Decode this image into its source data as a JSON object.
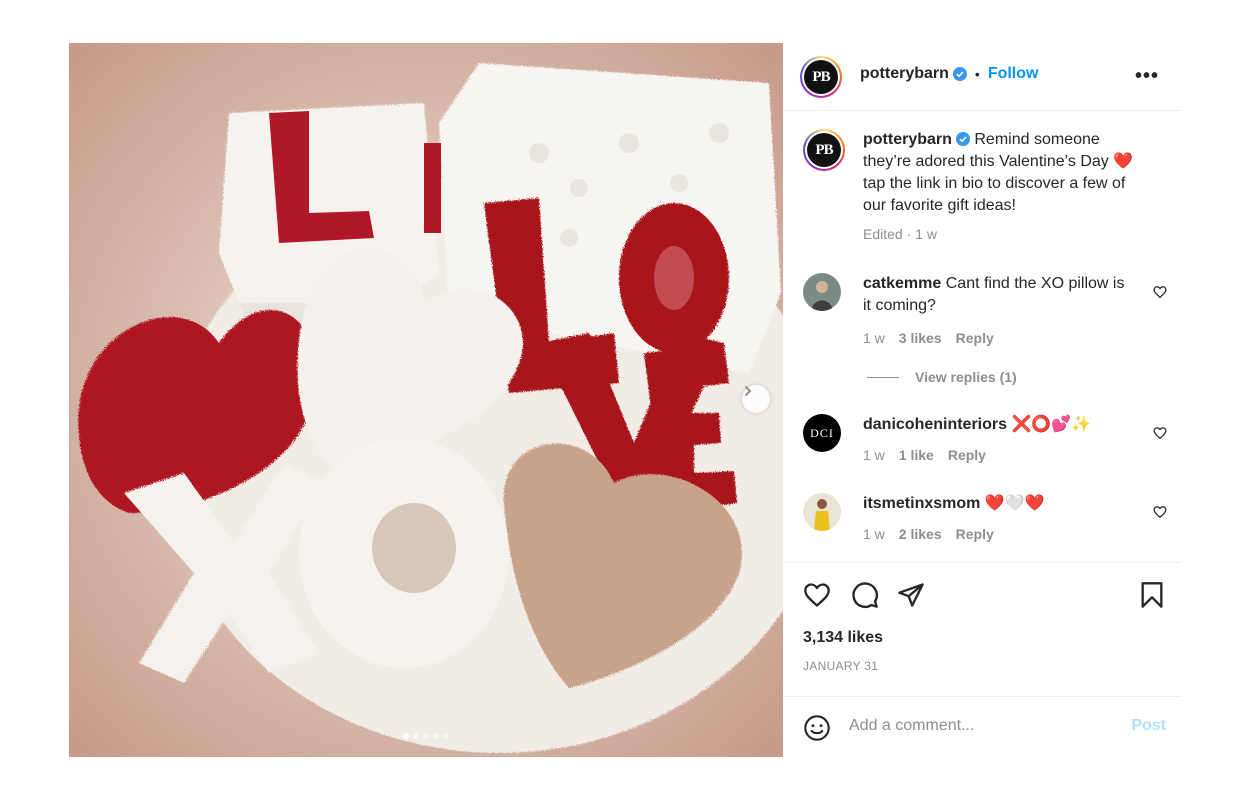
{
  "post": {
    "account": {
      "username": "potterybarn",
      "avatar_initials": "PB",
      "verified": true,
      "follow_label": "Follow",
      "more_label": "•••"
    },
    "media": {
      "slide_count": 5,
      "active_slide": 1,
      "next_icon": "chevron-right-icon"
    },
    "caption": {
      "username": "potterybarn",
      "text": "Remind someone they’re adored this Valentine’s Day ❤️ tap the link in bio to discover a few of our favorite gift ideas!",
      "edited_label": "Edited",
      "time": "1 w"
    },
    "comments": [
      {
        "username": "catkemme",
        "text": "Cant find the XO pillow is it coming?",
        "time": "1 w",
        "likes": "3 likes",
        "reply_label": "Reply"
      },
      {
        "username": "danicoheninteriors",
        "text": "❌⭕💕✨",
        "time": "1 w",
        "likes": "1 like",
        "reply_label": "Reply",
        "avatar_text": "DCI"
      },
      {
        "username": "itsmetinxsmom",
        "text": "❤️🤍❤️",
        "time": "1 w",
        "likes": "2 likes",
        "reply_label": "Reply"
      }
    ],
    "view_replies_label": "View replies (1)",
    "likes_count": "3,134 likes",
    "date": "JANUARY 31",
    "comment_box": {
      "placeholder": "Add a comment...",
      "post_label": "Post"
    },
    "colors": {
      "accent_blue": "#0095f6",
      "post_disabled": "#b2dffc",
      "text_primary": "#262626",
      "text_secondary": "#8e8e8e",
      "pillow_red": "#a8141f",
      "pillow_cream": "#f3efe8",
      "pillow_tan": "#c9a28c"
    }
  }
}
